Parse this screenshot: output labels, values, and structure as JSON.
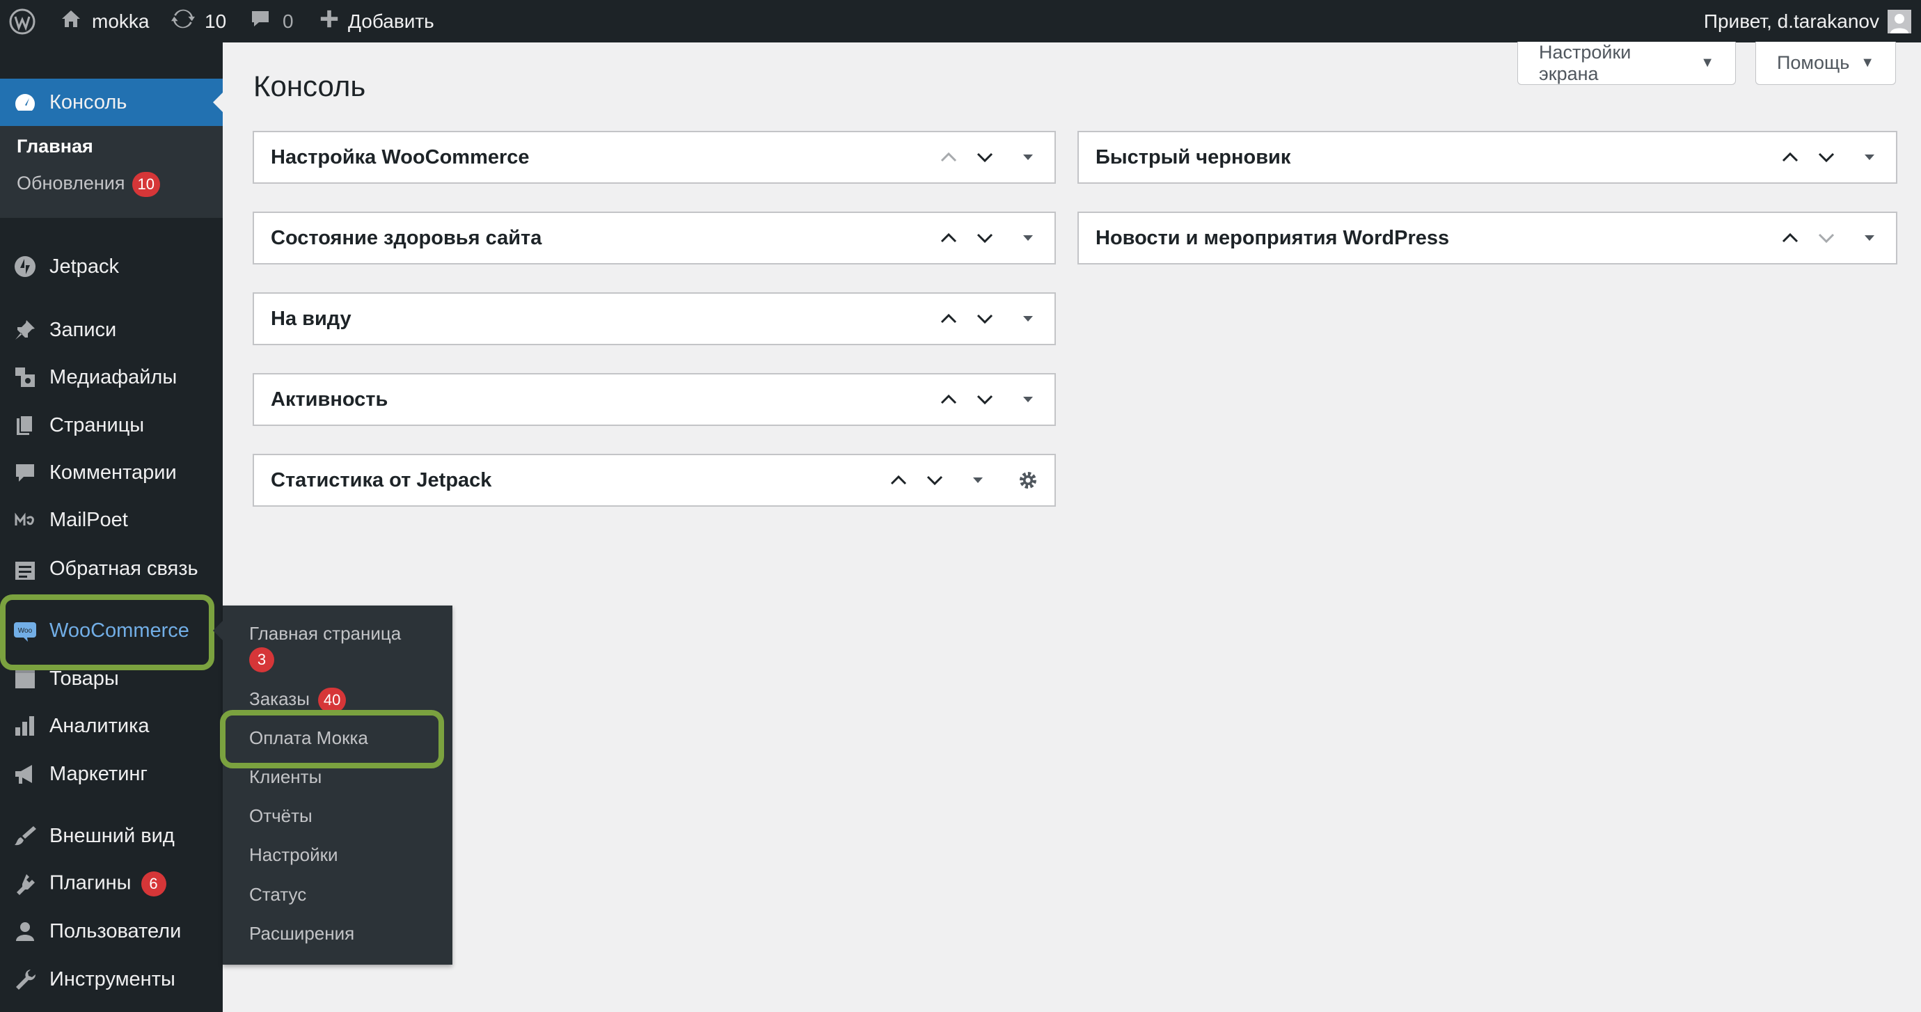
{
  "adminbar": {
    "site_name": "mokka",
    "updates_count": "10",
    "comments_count": "0",
    "add_new": "Добавить",
    "greeting": "Привет, d.tarakanov"
  },
  "header": {
    "title": "Консоль",
    "screen_options": "Настройки экрана",
    "help": "Помощь"
  },
  "sidebar": {
    "console": "Консоль",
    "home": "Главная",
    "updates": "Обновления",
    "updates_badge": "10",
    "items": [
      {
        "label": "Jetpack",
        "icon": "jetpack-icon"
      },
      {
        "label": "Записи",
        "icon": "pin-icon"
      },
      {
        "label": "Медиафайлы",
        "icon": "media-icon"
      },
      {
        "label": "Страницы",
        "icon": "pages-icon"
      },
      {
        "label": "Комментарии",
        "icon": "comment-icon"
      },
      {
        "label": "MailPoet",
        "icon": "mailpoet-icon"
      },
      {
        "label": "Обратная связь",
        "icon": "feedback-icon"
      },
      {
        "label": "WooCommerce",
        "icon": "woo-icon"
      },
      {
        "label": "Товары",
        "icon": "products-icon"
      },
      {
        "label": "Аналитика",
        "icon": "analytics-icon"
      },
      {
        "label": "Маркетинг",
        "icon": "megaphone-icon"
      },
      {
        "label": "Внешний вид",
        "icon": "brush-icon"
      },
      {
        "label": "Плагины",
        "icon": "plugin-icon",
        "badge": "6"
      },
      {
        "label": "Пользователи",
        "icon": "user-icon"
      },
      {
        "label": "Инструменты",
        "icon": "wrench-icon"
      }
    ]
  },
  "woo_flyout": {
    "items": [
      {
        "label": "Главная страница",
        "badge": "3"
      },
      {
        "label": "Заказы",
        "badge": "40"
      },
      {
        "label": "Оплата Мокка"
      },
      {
        "label": "Клиенты"
      },
      {
        "label": "Отчёты"
      },
      {
        "label": "Настройки"
      },
      {
        "label": "Статус"
      },
      {
        "label": "Расширения"
      }
    ]
  },
  "widgets": {
    "left": [
      "Настройка WooCommerce",
      "Состояние здоровья сайта",
      "На виду",
      "Активность",
      "Статистика от Jetpack"
    ],
    "right": [
      "Быстрый черновик",
      "Новости и мероприятия WordPress"
    ]
  },
  "colors": {
    "admin_dark": "#1d2327",
    "accent_blue": "#2271b1",
    "highlight_green": "#7ba23f",
    "badge_red": "#d63638"
  }
}
